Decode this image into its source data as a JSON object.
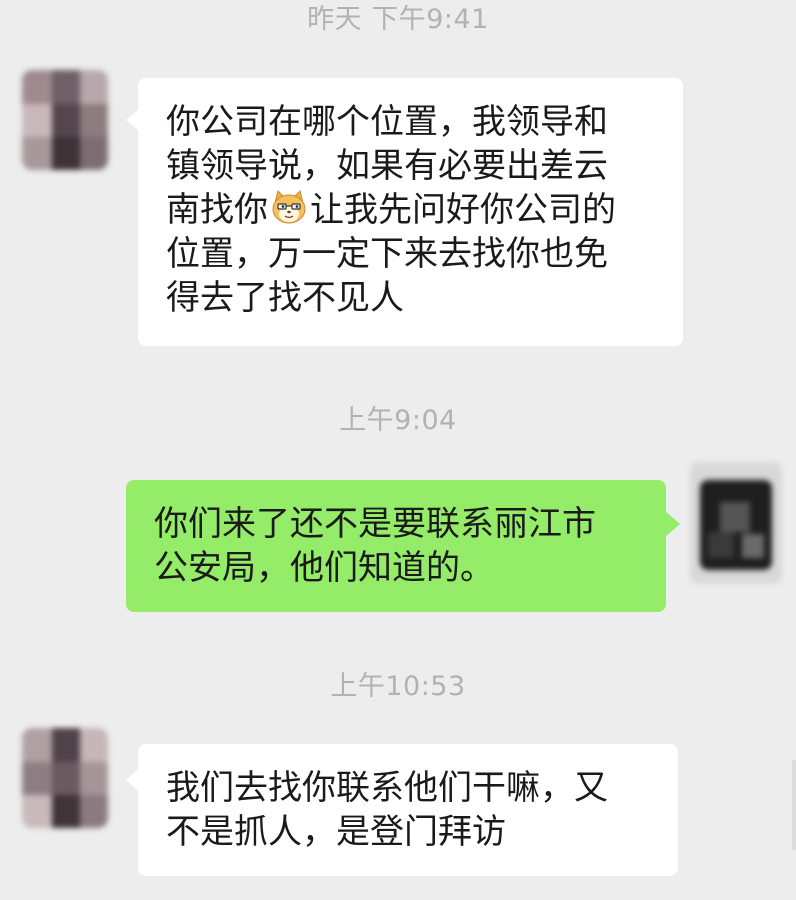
{
  "timestamps": [
    "昨天 下午9:41",
    "上午9:04",
    "上午10:53"
  ],
  "messages": [
    {
      "direction": "incoming",
      "lines": [
        "你公司在哪个位置，我领导和",
        "镇领导说，如果有必要出差云",
        "南找你",
        "让我先问好你公司的",
        "位置，万一定下来去找你也免",
        "得去了找不见人"
      ],
      "emoji": "cat-face-emoji"
    },
    {
      "direction": "outgoing",
      "lines": [
        "你们来了还不是要联系丽江市",
        "公安局，他们知道的。"
      ]
    },
    {
      "direction": "incoming",
      "lines": [
        "我们去找你联系他们干嘛，又",
        "不是抓人，是登门拜访"
      ]
    }
  ],
  "colors": {
    "background": "#ededed",
    "incoming_bubble": "#ffffff",
    "outgoing_bubble": "#95ec69",
    "timestamp_text": "#b2b2b2"
  }
}
